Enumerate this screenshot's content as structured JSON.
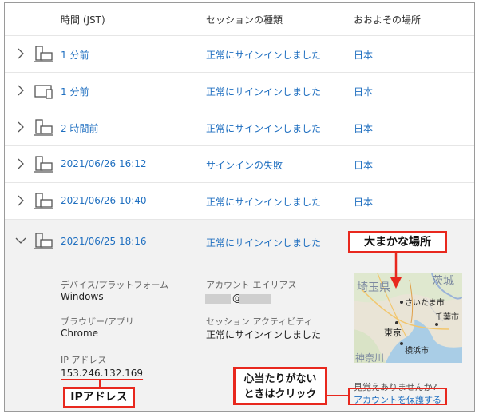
{
  "header": {
    "time": "時間 (JST)",
    "session_type": "セッションの種類",
    "location": "おおよその場所"
  },
  "rows": [
    {
      "device": "desktop",
      "time": "1 分前",
      "type": "正常にサインインしました",
      "location": "日本"
    },
    {
      "device": "tablet",
      "time": "1 分前",
      "type": "正常にサインインしました",
      "location": "日本"
    },
    {
      "device": "desktop",
      "time": "2 時間前",
      "type": "正常にサインインしました",
      "location": "日本"
    },
    {
      "device": "desktop",
      "time": "2021/06/26 16:12",
      "type": "サインインの失敗",
      "location": "日本"
    },
    {
      "device": "desktop",
      "time": "2021/06/26 10:40",
      "type": "正常にサインインしました",
      "location": "日本"
    },
    {
      "device": "desktop",
      "time": "2021/06/25 18:16",
      "type": "正常にサインインしました",
      "location": "日本"
    }
  ],
  "details": {
    "device_platform_label": "デバイス/プラットフォーム",
    "device_platform_value": "Windows",
    "browser_label": "ブラウザー/アプリ",
    "browser_value": "Chrome",
    "ip_label": "IP アドレス",
    "ip_value": "153.246.132.169",
    "alias_label": "アカウント エイリアス",
    "alias_value": "@",
    "activity_label": "セッション アクティビティ",
    "activity_value": "正常にサインインしました",
    "question": "見覚えありませんか?",
    "protect_link": "アカウントを保護する"
  },
  "map": {
    "labels": [
      "埼玉県",
      "茨城",
      "さいたま市",
      "千葉市",
      "東京",
      "横浜市",
      "神奈川"
    ]
  },
  "annotations": {
    "rough_location": "大まかな場所",
    "ip_address": "IPアドレス",
    "click_hint_line1": "心当たりがない",
    "click_hint_line2": "ときはクリック"
  },
  "colors": {
    "link": "#1f6fc0",
    "callout": "#e8281e",
    "expanded_bg": "#f2f2f2"
  }
}
